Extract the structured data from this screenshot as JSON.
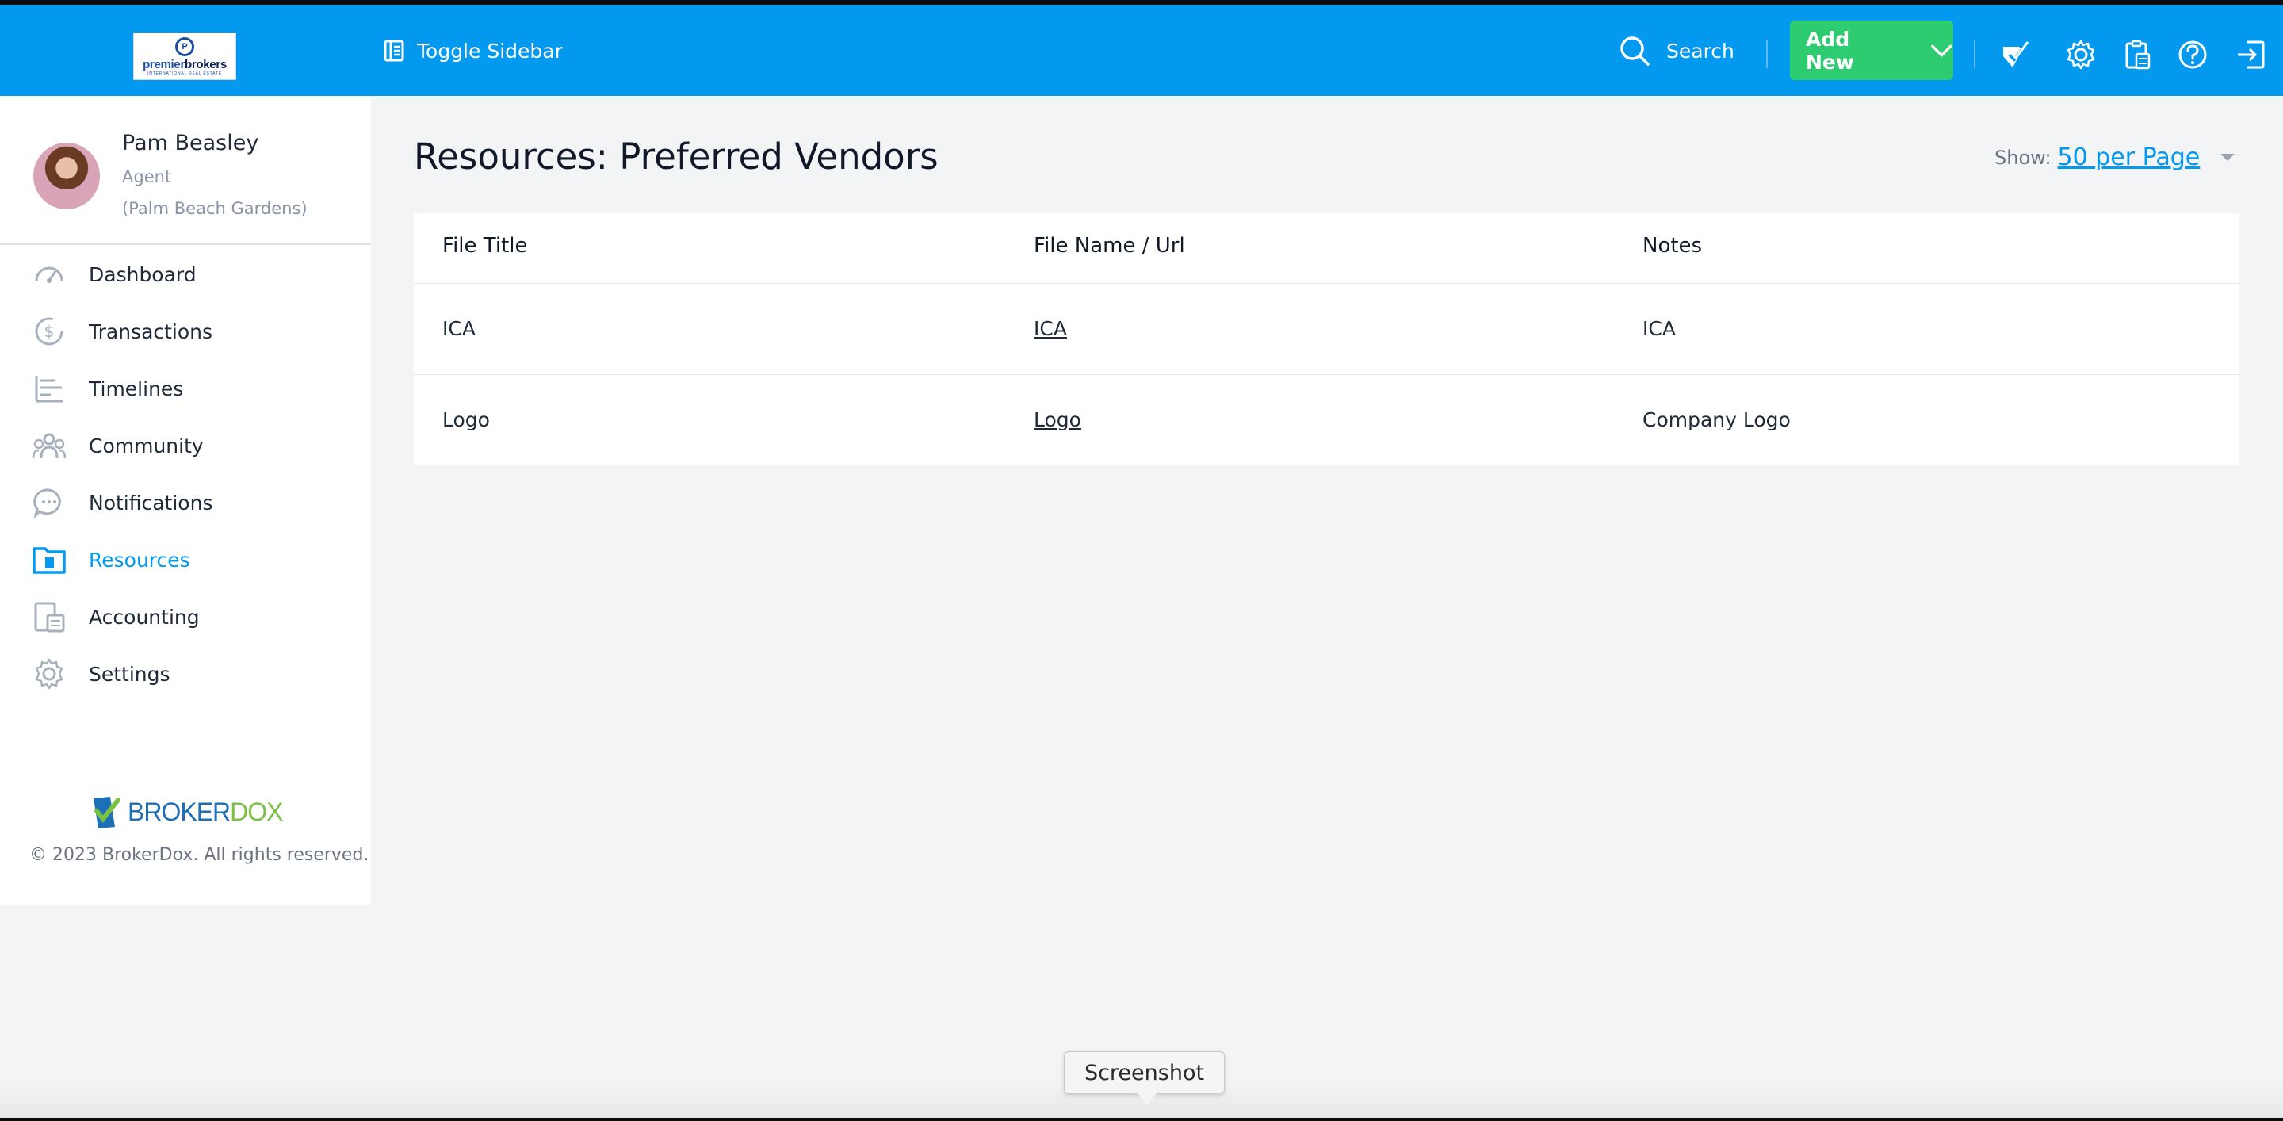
{
  "brand": {
    "logo_word_a": "premier",
    "logo_word_b": "brokers",
    "logo_tag": "INTERNATIONAL REAL ESTATE",
    "footer_word_a": "BROKER",
    "footer_word_b": "DOX",
    "copyright": "© 2023 BrokerDox. All rights reserved."
  },
  "header": {
    "toggle_sidebar_label": "Toggle Sidebar",
    "search_label": "Search",
    "add_new_label": "Add New",
    "accent_color": "#0399ef",
    "add_new_color": "#2ecc71",
    "icons": [
      "checklist-icon",
      "gear-icon",
      "calculator-clipboard-icon",
      "help-icon",
      "logout-icon"
    ]
  },
  "profile": {
    "name": "Pam Beasley",
    "role": "Agent",
    "office": "(Palm Beach Gardens)"
  },
  "sidebar": {
    "items": [
      {
        "label": "Dashboard",
        "icon": "speedometer-icon"
      },
      {
        "label": "Transactions",
        "icon": "dollar-icon"
      },
      {
        "label": "Timelines",
        "icon": "timeline-icon"
      },
      {
        "label": "Community",
        "icon": "people-icon"
      },
      {
        "label": "Notifications",
        "icon": "chat-bubble-icon"
      },
      {
        "label": "Resources",
        "icon": "folder-icon",
        "active": true
      },
      {
        "label": "Accounting",
        "icon": "calculator-icon"
      },
      {
        "label": "Settings",
        "icon": "gear-icon"
      }
    ]
  },
  "main": {
    "title": "Resources: Preferred Vendors",
    "show_label": "Show:",
    "per_page": "50 per Page",
    "table": {
      "columns": [
        "File Title",
        "File Name / Url",
        "Notes"
      ],
      "rows": [
        {
          "title": "ICA",
          "file": "ICA",
          "notes": "ICA"
        },
        {
          "title": "Logo",
          "file": "Logo",
          "notes": "Company Logo"
        }
      ]
    }
  },
  "tooltip": "Screenshot"
}
